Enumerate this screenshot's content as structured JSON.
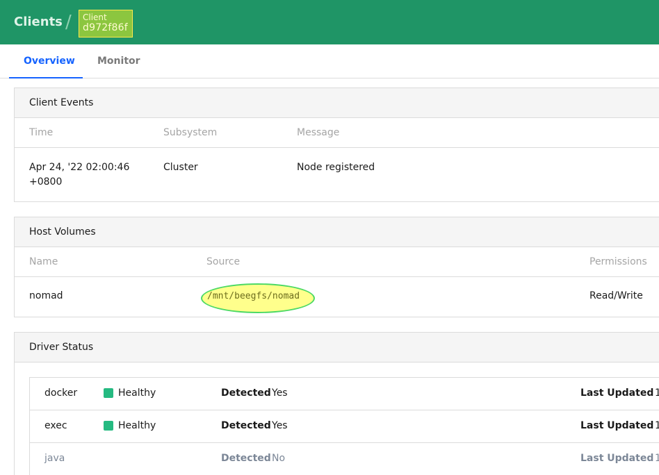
{
  "breadcrumb": {
    "clients_label": "Clients",
    "separator": "/",
    "client_label": "Client",
    "client_id": "d972f86f"
  },
  "tabs": [
    {
      "label": "Overview",
      "active": true
    },
    {
      "label": "Monitor",
      "active": false
    }
  ],
  "client_events": {
    "title": "Client Events",
    "columns": [
      "Time",
      "Subsystem",
      "Message"
    ],
    "rows": [
      {
        "time_line1": "Apr 24, '22 02:00:46",
        "time_line2": "+0800",
        "subsystem": "Cluster",
        "message": "Node registered"
      }
    ]
  },
  "host_volumes": {
    "title": "Host Volumes",
    "columns": [
      "Name",
      "Source",
      "Permissions"
    ],
    "rows": [
      {
        "name": "nomad",
        "source": "/mnt/beegfs/nomad",
        "permissions": "Read/Write"
      }
    ]
  },
  "driver_status": {
    "title": "Driver Status",
    "detected_label": "Detected",
    "last_updated_label": "Last Updated",
    "rows": [
      {
        "name": "docker",
        "health": "Healthy",
        "detected": "Yes",
        "last_updated": "1"
      },
      {
        "name": "exec",
        "health": "Healthy",
        "detected": "Yes",
        "last_updated": "1"
      },
      {
        "name": "java",
        "health": "",
        "detected": "No",
        "last_updated": "1"
      }
    ]
  },
  "colors": {
    "header_bg": "#1f9566",
    "active_tab": "#1563ff",
    "healthy": "#25ba81",
    "highlight_fill": "#ffff8c",
    "highlight_border": "#4cd964"
  }
}
